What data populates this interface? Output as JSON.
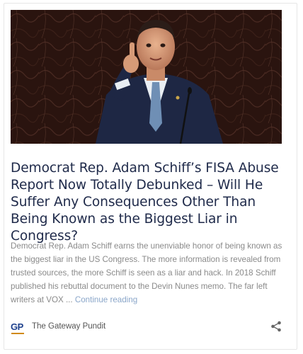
{
  "article": {
    "headline": "Democrat Rep. Adam Schiff’s FISA Abuse Report Now Totally Debunked – Will He Suffer Any Consequences Other Than Being Known as the Biggest Liar in Congress?",
    "snippet": "Democrat Rep. Adam Schiff earns the unenviable honor of being known as the biggest liar in the US Congress.  The more information is revealed from trusted sources, the more Schiff is seen as a liar and hack.  In 2018 Schiff published his rebuttal document to the Devin Nunes memo. The far left writers at VOX ... ",
    "continue_label": "Continue reading"
  },
  "source": {
    "logo_text": "GP",
    "name": "The Gateway Pundit"
  },
  "icons": {
    "share": "share-icon"
  },
  "colors": {
    "headline": "#1f2a4a",
    "snippet": "#8a8a8a",
    "link": "#8aa6c9",
    "logo": "#1c3f8c",
    "logo_underline": "#d08a1a"
  }
}
